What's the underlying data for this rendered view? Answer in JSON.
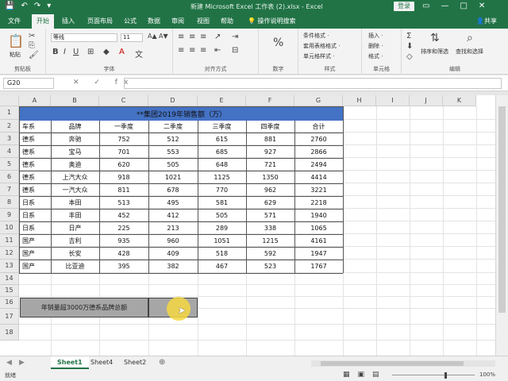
{
  "window": {
    "title": "新建 Microsoft Excel 工作表 (2).xlsx  -  Excel",
    "login": "登录",
    "controls": {
      "restore": "▭",
      "minimize": "—",
      "maximize": "□",
      "close": "✕"
    }
  },
  "qat": {
    "save": "💾",
    "undo": "↶",
    "redo": "↷",
    "more": "▾"
  },
  "ribbon_tabs": [
    "文件",
    "开始",
    "插入",
    "页面布局",
    "公式",
    "数据",
    "审阅",
    "视图",
    "帮助"
  ],
  "active_tab": "开始",
  "tell_me": "操作说明搜索",
  "share": "共享",
  "ribbon": {
    "clipboard": {
      "label": "剪贴板",
      "paste": "粘贴"
    },
    "font": {
      "label": "字体",
      "name": "等线",
      "size": "11"
    },
    "alignment": {
      "label": "对齐方式"
    },
    "number": {
      "label": "数字",
      "format": "%"
    },
    "styles": {
      "label": "样式",
      "items": [
        "条件格式 ·",
        "套用表格格式 ·",
        "单元格样式 ·"
      ]
    },
    "cells": {
      "label": "单元格",
      "items": [
        "插入 ·",
        "删除 ·",
        "格式 ·"
      ]
    },
    "editing": {
      "label": "编辑",
      "sort": "排序和筛选",
      "find": "查找和选择"
    }
  },
  "formula_bar": {
    "name_box": "G20",
    "formula": "",
    "icons": "✕ ✓ fx"
  },
  "grid": {
    "columns": [
      "A",
      "B",
      "C",
      "D",
      "E",
      "F",
      "G",
      "H",
      "I",
      "J",
      "K"
    ],
    "rows": [
      "1",
      "2",
      "3",
      "4",
      "5",
      "6",
      "7",
      "8",
      "9",
      "10",
      "11",
      "12",
      "13",
      "14",
      "15",
      "16",
      "17",
      "18"
    ],
    "table_title": "**集团2019年销售额（万）",
    "headers": [
      "车系",
      "品牌",
      "一季度",
      "二季度",
      "三季度",
      "四季度",
      "合计"
    ],
    "data": [
      [
        "德系",
        "奔驰",
        "752",
        "512",
        "615",
        "881",
        "2760"
      ],
      [
        "德系",
        "宝马",
        "701",
        "553",
        "685",
        "927",
        "2866"
      ],
      [
        "德系",
        "奥迪",
        "620",
        "505",
        "648",
        "721",
        "2494"
      ],
      [
        "德系",
        "上汽大众",
        "918",
        "1021",
        "1125",
        "1350",
        "4414"
      ],
      [
        "德系",
        "一汽大众",
        "811",
        "678",
        "770",
        "962",
        "3221"
      ],
      [
        "日系",
        "本田",
        "513",
        "495",
        "581",
        "629",
        "2218"
      ],
      [
        "日系",
        "丰田",
        "452",
        "412",
        "505",
        "571",
        "1940"
      ],
      [
        "日系",
        "日产",
        "225",
        "213",
        "289",
        "338",
        "1065"
      ],
      [
        "国产",
        "吉利",
        "935",
        "960",
        "1051",
        "1215",
        "4161"
      ],
      [
        "国产",
        "长安",
        "428",
        "409",
        "518",
        "592",
        "1947"
      ],
      [
        "国产",
        "比亚迪",
        "395",
        "382",
        "467",
        "523",
        "1767"
      ]
    ],
    "summary_label": "年销量超3000万德系品牌总额",
    "summary_value": ""
  },
  "sheets": [
    "Sheet1",
    "Sheet4",
    "Sheet2"
  ],
  "active_sheet": "Sheet1",
  "add_sheet": "⊕",
  "status": {
    "ready": "就绪",
    "zoom": "100%"
  },
  "colors": {
    "excel_green": "#217346",
    "title_fill": "#4472c4",
    "summary_fill": "#a6a6a6"
  }
}
